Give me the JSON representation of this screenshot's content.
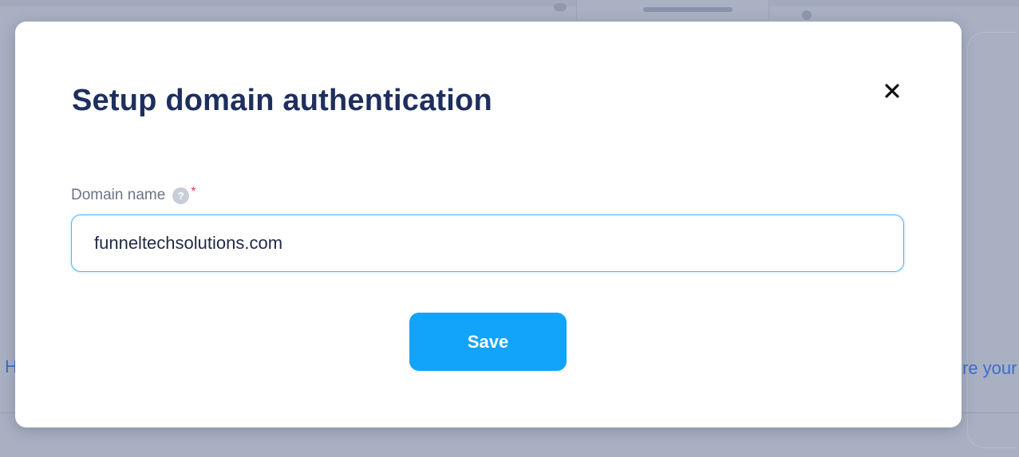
{
  "background": {
    "left_text": "H",
    "right_text": "re your"
  },
  "modal": {
    "title": "Setup domain authentication",
    "close_icon": "close-icon",
    "field": {
      "label": "Domain name",
      "help_icon": "question-mark-icon",
      "help_glyph": "?",
      "required_mark": "*",
      "value": "funneltechsolutions.com"
    },
    "save_label": "Save"
  },
  "colors": {
    "title": "#1e2f5e",
    "accent": "#12a3fb",
    "input_border": "#4ab4f5",
    "required": "#e53950",
    "overlay": "#a3aabd"
  }
}
